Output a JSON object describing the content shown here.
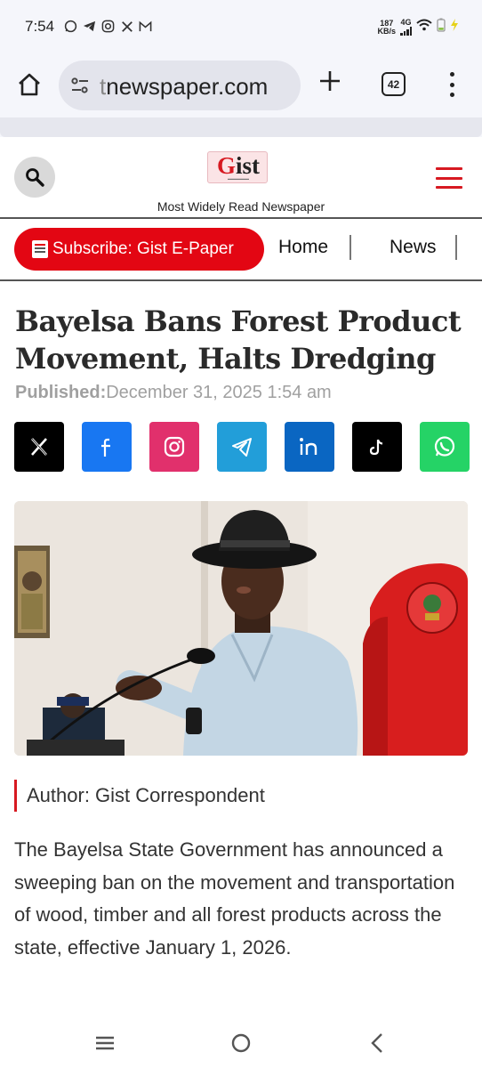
{
  "status_bar": {
    "time": "7:54",
    "net_speed_value": "187",
    "net_speed_unit": "KB/s",
    "network_type": "4G",
    "notification_icons": [
      "whatsapp-icon",
      "telegram-icon",
      "instagram-icon",
      "x-icon",
      "gmail-icon"
    ]
  },
  "browser": {
    "url_prefix": "t",
    "url_domain": "newspaper.com",
    "tab_count": "42"
  },
  "site": {
    "logo_text_g": "G",
    "logo_text_rest": "ist",
    "tagline": "Most Widely Read Newspaper",
    "accent_color": "#d71921"
  },
  "nav": {
    "subscribe_label": "Subscribe: Gist E-Paper",
    "links": [
      "Home",
      "News"
    ]
  },
  "article": {
    "headline": "Bayelsa Bans Forest Product Movement, Halts Dredging",
    "published_label": "Published:",
    "published_date": "December 31, 2025 1:54 am",
    "share_buttons": [
      {
        "name": "x",
        "color": "#000000"
      },
      {
        "name": "facebook",
        "color": "#1877f2"
      },
      {
        "name": "instagram",
        "color": "#e1306c"
      },
      {
        "name": "telegram",
        "color": "#229ed9"
      },
      {
        "name": "linkedin",
        "color": "#0a66c2"
      },
      {
        "name": "tiktok",
        "color": "#000000"
      },
      {
        "name": "whatsapp",
        "color": "#25d366"
      }
    ],
    "author": "Author: Gist Correspondent",
    "body": "The Bayelsa State Government has announced a sweeping ban on the movement and transportation of wood, timber and all forest products across the state, effective January 1, 2026."
  }
}
